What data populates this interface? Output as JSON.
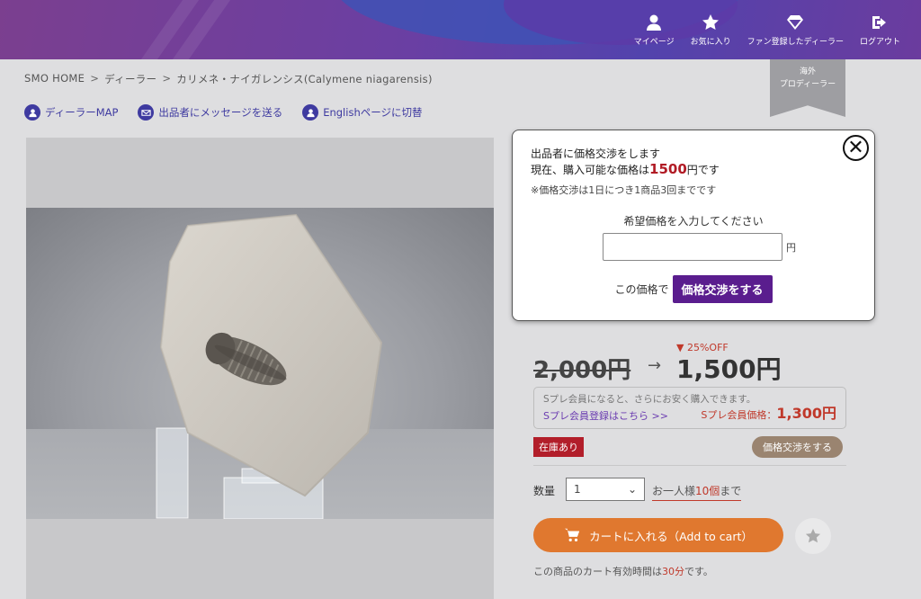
{
  "nav": [
    {
      "label": "マイページ",
      "icon": "user-icon"
    },
    {
      "label": "お気に入り",
      "icon": "star-icon"
    },
    {
      "label": "ファン登録したディーラー",
      "icon": "diamond-icon"
    },
    {
      "label": "ログアウト",
      "icon": "logout-icon"
    }
  ],
  "breadcrumb": {
    "home": "SMO HOME",
    "sep": ">",
    "dealer": "ディーラー",
    "current": "カリメネ・ナイガレンシス(Calymene niagarensis)"
  },
  "ribbon": {
    "line1": "海外",
    "line2": "プロディーラー"
  },
  "links": {
    "map": "ディーラーMAP",
    "message": "出品者にメッセージを送る",
    "english": "Englishページに切替"
  },
  "popup": {
    "line1": "出品者に価格交渉をします",
    "line2_pre": "現在、購入可能な価格は",
    "line2_price": "1500",
    "line2_post": "円です",
    "note": "※価格交渉は1日につき1商品3回までです",
    "ask": "希望価格を入力してください",
    "unit": "円",
    "action_prefix": "この価格で",
    "action_button": "価格交渉をする",
    "close": "✕"
  },
  "price": {
    "discount": "▼ 25%OFF",
    "old": "2,000円",
    "arrow": "→",
    "new": "1,500円"
  },
  "spre": {
    "text": "Sプレ会員になると、さらにお安く購入できます。",
    "link": "Sプレ会員登録はこちら >>",
    "member_label": "Sプレ会員価格：",
    "member_price": "1,300円"
  },
  "stock": "在庫あり",
  "negotiate_pill": "価格交渉をする",
  "quantity": {
    "label": "数量",
    "value": "1",
    "limit_pre": "お一人様",
    "limit_num": "10個",
    "limit_post": "まで"
  },
  "cart": {
    "label": "カートに入れる（Add to cart）"
  },
  "cart_time": {
    "pre": "この商品のカート有効時間は",
    "num": "30分",
    "post": "です。"
  },
  "colors": {
    "header": "#5243ad",
    "accent": "#5a1d8e",
    "cart": "#e0782f",
    "sale": "#c0392b"
  }
}
